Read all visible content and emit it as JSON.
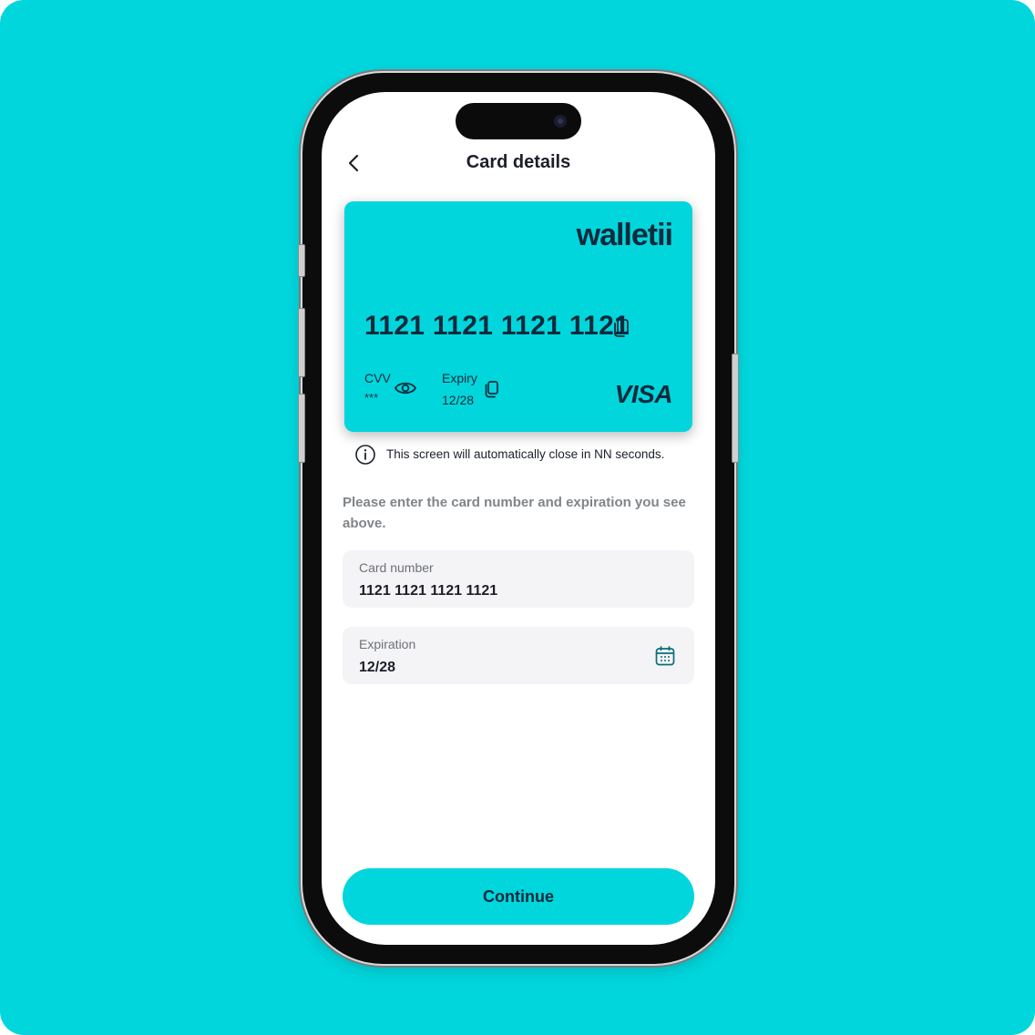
{
  "header": {
    "title": "Card details"
  },
  "card": {
    "brand": "walletii",
    "number": "1121 1121 1121 1121",
    "cvv_label": "CVV",
    "cvv_value": "***",
    "expiry_label": "Expiry",
    "expiry_value": "12/28",
    "network": "VISA"
  },
  "notice": "This screen will automatically close in NN seconds.",
  "instruction": "Please enter the card number and expiration you see above.",
  "form": {
    "card_number": {
      "label": "Card number",
      "value": "1121 1121 1121 1121"
    },
    "expiration": {
      "label": "Expiration",
      "value": "12/28"
    }
  },
  "continue_label": "Continue",
  "icons": [
    "chevron-left-icon",
    "copy-icon",
    "eye-icon",
    "info-icon",
    "calendar-icon"
  ],
  "colors": {
    "accent": "#00d6dc",
    "text_dark": "#0f2a3c",
    "field_bg": "#f4f4f6"
  }
}
